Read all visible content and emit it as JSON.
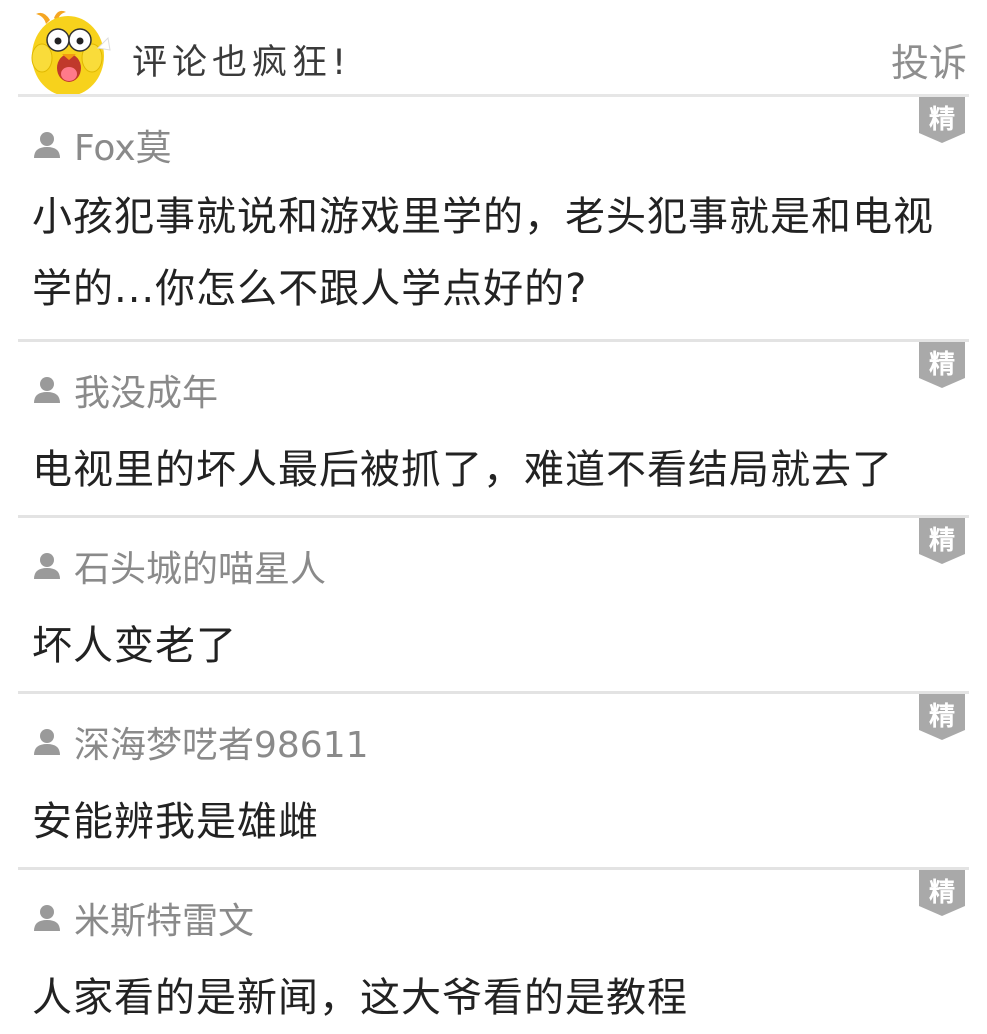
{
  "header": {
    "title": "评论也疯狂!",
    "report_label": "投诉",
    "mascot_icon": "yellow-chick-mascot"
  },
  "badge_label": "精",
  "comments": [
    {
      "author": "Fox莫",
      "text": "小孩犯事就说和游戏里学的，老头犯事就是和电视学的...你怎么不跟人学点好的?"
    },
    {
      "author": "我没成年",
      "text": "电视里的坏人最后被抓了，难道不看结局就去了"
    },
    {
      "author": "石头城的喵星人",
      "text": "坏人变老了"
    },
    {
      "author": "深海梦呓者98611",
      "text": "安能辨我是雄雌"
    },
    {
      "author": "米斯特雷文",
      "text": "人家看的是新闻，这大爷看的是教程"
    }
  ],
  "colors": {
    "badge": "#a9a9a9",
    "author": "#8a8a8a",
    "text": "#222222",
    "divider": "#e3e3e3",
    "mascot": "#f7d21c"
  }
}
